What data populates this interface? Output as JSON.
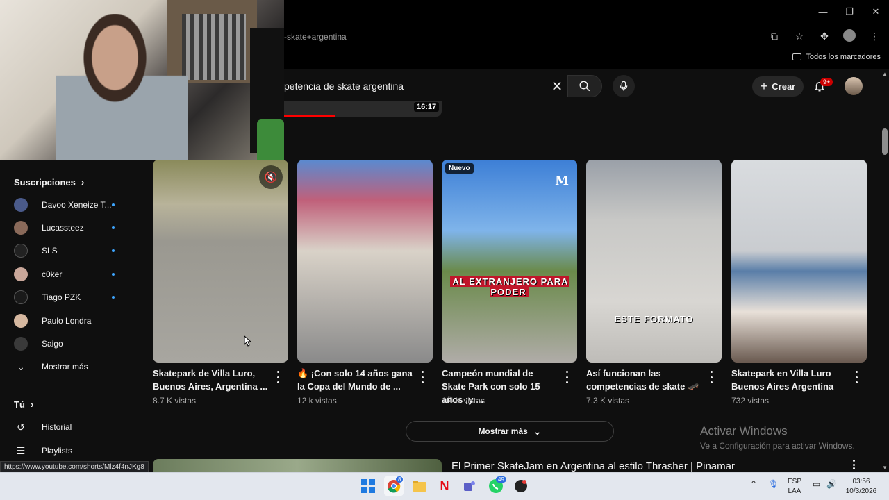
{
  "browser": {
    "address_fragment": "-skate+argentina",
    "bookmarks_label": "Todos los marcadores",
    "status_url": "https://www.youtube.com/shorts/Mlz4f4nJKg8"
  },
  "header": {
    "search_query": "petencia de skate argentina",
    "create_label": "Crear",
    "notifications_badge": "9+"
  },
  "prev_video": {
    "duration": "16:17"
  },
  "sidebar": {
    "subscriptions_title": "Suscripciones",
    "subscriptions": [
      {
        "name": "Davoo Xeneize T...",
        "dot": true,
        "color": "#4a5a8a"
      },
      {
        "name": "Lucassteez",
        "dot": true,
        "color": "#8a6a5a"
      },
      {
        "name": "SLS",
        "dot": true,
        "color": "#222222"
      },
      {
        "name": "c0ker",
        "dot": true,
        "color": "#c9a79a"
      },
      {
        "name": "Tiago PZK",
        "dot": true,
        "color": "#1a1a1a"
      },
      {
        "name": "Paulo Londra",
        "dot": false,
        "color": "#d6b8a0"
      },
      {
        "name": "Saigo",
        "dot": false,
        "color": "#3a3a3a"
      }
    ],
    "show_more": "Mostrar más",
    "you_title": "Tú",
    "history": "Historial",
    "playlists": "Playlists"
  },
  "shorts": [
    {
      "title": "Skatepark de Villa Luro, Buenos Aires, Argentina ...",
      "views": "8.7 K vistas"
    },
    {
      "title": "🔥 ¡Con solo 14 años gana la Copa del Mundo de ...",
      "views": "12 k vistas"
    },
    {
      "title": "Campeón mundial de Skate Park con solo 15 años ¡y ...",
      "views": "1.4 K vistas",
      "badge": "Nuevo",
      "logo": "M",
      "caption": "AL EXTRANJERO PARA PODER"
    },
    {
      "title": "Así funcionan las competencias de skate 🛹",
      "views": "7.3 K vistas",
      "caption": "ESTE FORMATO"
    },
    {
      "title": "Skatepark en Villa Luro Buenos Aires Argentina",
      "views": "732 vistas"
    }
  ],
  "show_more_button": "Mostrar más",
  "next_video": {
    "title": "El Primer SkateJam en Argentina al estilo Thrasher | Pinamar"
  },
  "watermark": {
    "line1": "Activar Windows",
    "line2": "Ve a Configuración para activar Windows."
  },
  "taskbar": {
    "chrome_badge": "8",
    "whatsapp_badge": "49",
    "lang": "ESP",
    "layout": "LAA",
    "time": "03:56",
    "date": "10/3/2026"
  }
}
